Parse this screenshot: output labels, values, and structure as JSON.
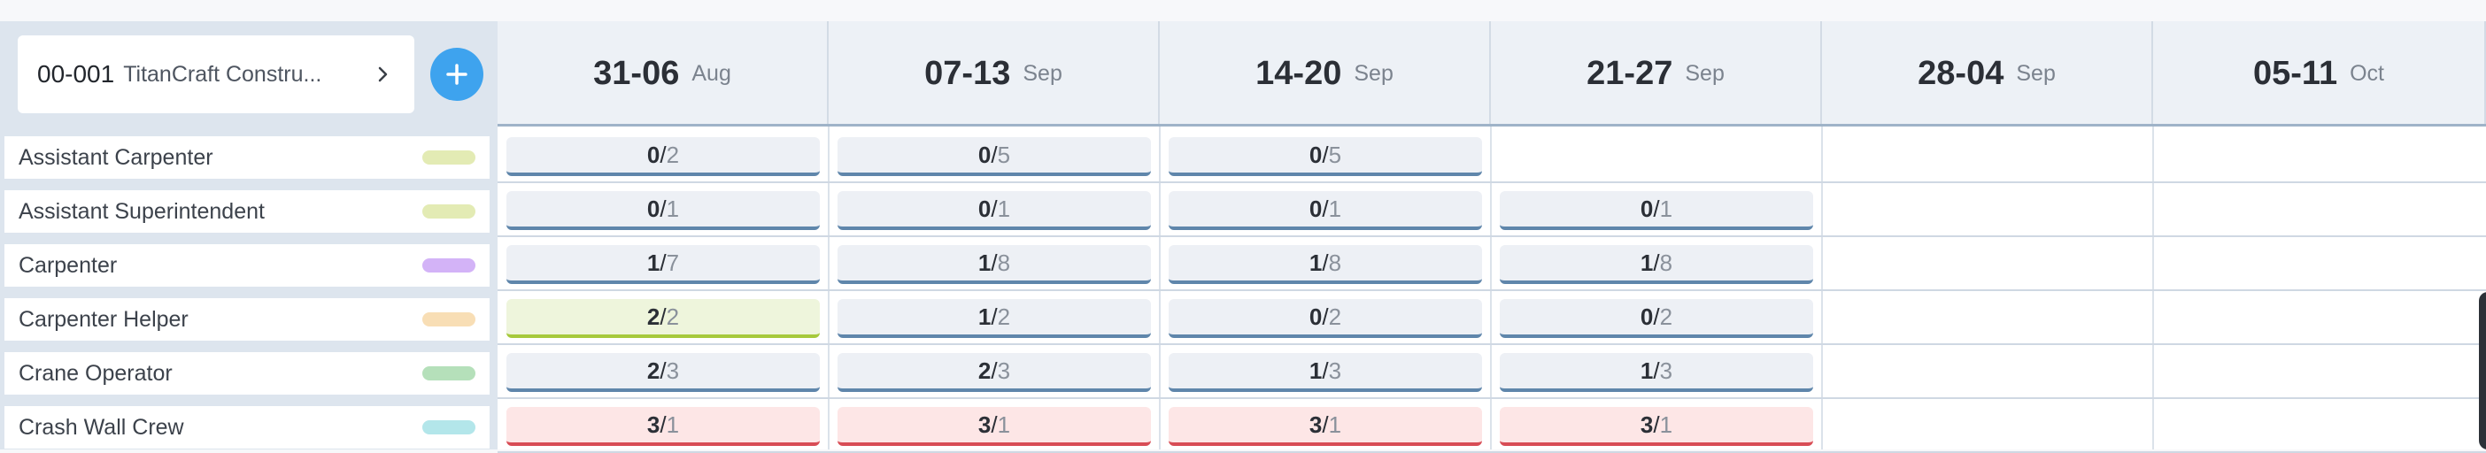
{
  "project": {
    "code": "00-001",
    "name": "TitanCraft Constru..."
  },
  "weeks": [
    {
      "range": "31-06",
      "month": "Aug"
    },
    {
      "range": "07-13",
      "month": "Sep"
    },
    {
      "range": "14-20",
      "month": "Sep"
    },
    {
      "range": "21-27",
      "month": "Sep"
    },
    {
      "range": "28-04",
      "month": "Sep"
    },
    {
      "range": "05-11",
      "month": "Oct"
    }
  ],
  "roles": [
    {
      "label": "Assistant Carpenter",
      "color": "#e3ebb4"
    },
    {
      "label": "Assistant Superintendent",
      "color": "#e3ebb4"
    },
    {
      "label": "Carpenter",
      "color": "#d3b3f7"
    },
    {
      "label": "Carpenter Helper",
      "color": "#f8deb5"
    },
    {
      "label": "Crane Operator",
      "color": "#b5e0ba"
    },
    {
      "label": "Crash Wall Crew",
      "color": "#b3e6ea"
    }
  ],
  "allocations": [
    [
      {
        "num": "0",
        "den": "2",
        "status": "normal"
      },
      {
        "num": "0",
        "den": "5",
        "status": "normal"
      },
      {
        "num": "0",
        "den": "5",
        "status": "normal"
      },
      null,
      null,
      null
    ],
    [
      {
        "num": "0",
        "den": "1",
        "status": "normal"
      },
      {
        "num": "0",
        "den": "1",
        "status": "normal"
      },
      {
        "num": "0",
        "den": "1",
        "status": "normal"
      },
      {
        "num": "0",
        "den": "1",
        "status": "normal"
      },
      null,
      null
    ],
    [
      {
        "num": "1",
        "den": "7",
        "status": "normal"
      },
      {
        "num": "1",
        "den": "8",
        "status": "normal"
      },
      {
        "num": "1",
        "den": "8",
        "status": "normal"
      },
      {
        "num": "1",
        "den": "8",
        "status": "normal"
      },
      null,
      null
    ],
    [
      {
        "num": "2",
        "den": "2",
        "status": "full"
      },
      {
        "num": "1",
        "den": "2",
        "status": "normal"
      },
      {
        "num": "0",
        "den": "2",
        "status": "normal"
      },
      {
        "num": "0",
        "den": "2",
        "status": "normal"
      },
      null,
      null
    ],
    [
      {
        "num": "2",
        "den": "3",
        "status": "normal"
      },
      {
        "num": "2",
        "den": "3",
        "status": "normal"
      },
      {
        "num": "1",
        "den": "3",
        "status": "normal"
      },
      {
        "num": "1",
        "den": "3",
        "status": "normal"
      },
      null,
      null
    ],
    [
      {
        "num": "3",
        "den": "1",
        "status": "over"
      },
      {
        "num": "3",
        "den": "1",
        "status": "over"
      },
      {
        "num": "3",
        "den": "1",
        "status": "over"
      },
      {
        "num": "3",
        "den": "1",
        "status": "over"
      },
      null,
      null
    ]
  ],
  "icons": {
    "add": "plus-icon",
    "expand": "chevron-right-icon"
  },
  "colors": {
    "accent": "#3ea3ee",
    "normal_border": "#5f86ab",
    "full_border": "#a6c93c",
    "over_border": "#d84c55"
  }
}
